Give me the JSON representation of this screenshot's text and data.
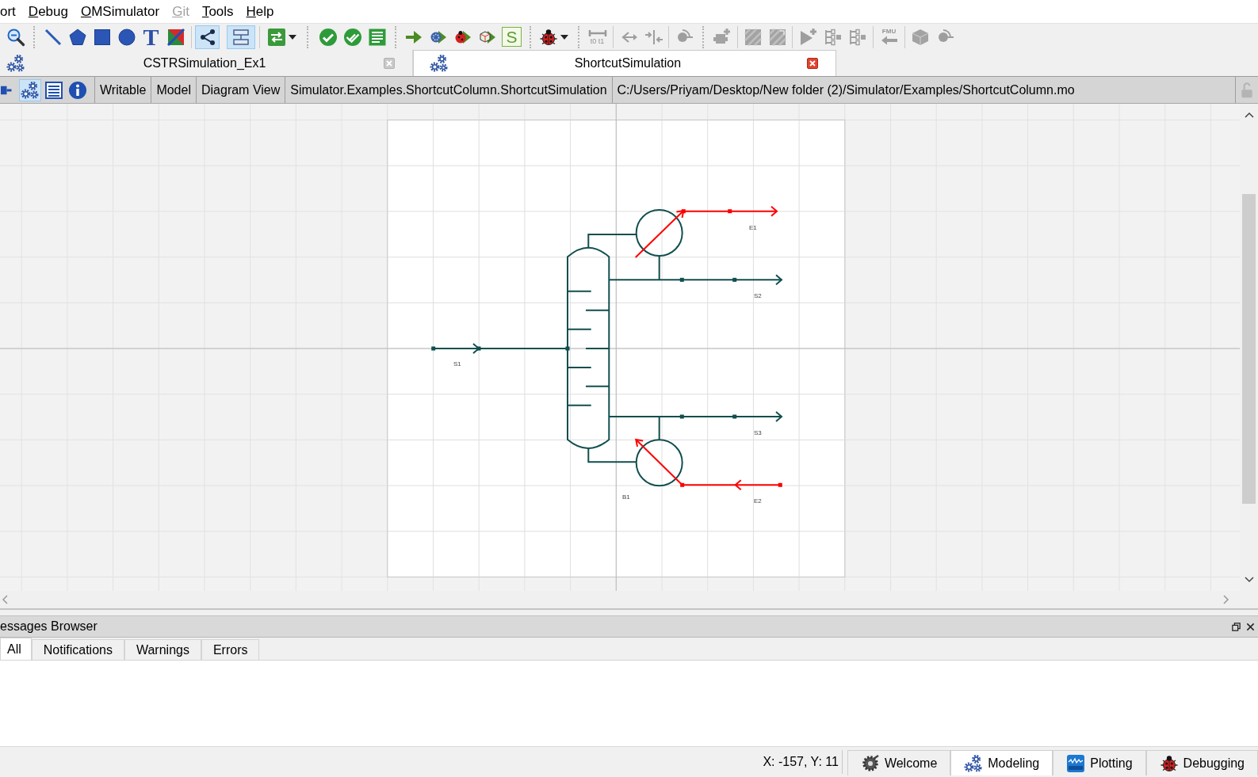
{
  "menu_bar": {
    "items": [
      {
        "label": "ort",
        "mnemonic": false,
        "disabled": false
      },
      {
        "label": "Debug",
        "mnemonic": true,
        "disabled": false
      },
      {
        "label": "OMSimulator",
        "mnemonic": true,
        "disabled": false
      },
      {
        "label": "Git",
        "mnemonic": true,
        "disabled": true
      },
      {
        "label": "Tools",
        "mnemonic": true,
        "disabled": false
      },
      {
        "label": "Help",
        "mnemonic": true,
        "disabled": false
      }
    ]
  },
  "toolbar": {
    "groups": [
      {
        "items": [
          {
            "pressed": false,
            "disabled": false
          }
        ]
      },
      {
        "items": [
          {
            "pressed": false,
            "disabled": false
          },
          {
            "pressed": false,
            "disabled": false
          },
          {
            "pressed": false,
            "disabled": false
          },
          {
            "pressed": false,
            "disabled": false
          },
          {
            "text": "T",
            "pressed": false,
            "disabled": false
          },
          {
            "pressed": false,
            "disabled": false
          }
        ]
      },
      {
        "items": [
          {
            "pressed": true,
            "disabled": false
          },
          {
            "pressed": true,
            "disabled": false
          }
        ]
      },
      {
        "items": [
          {
            "pressed": false,
            "disabled": false
          }
        ]
      },
      {
        "items": [
          {
            "pressed": false,
            "disabled": false
          },
          {
            "pressed": false,
            "disabled": false
          },
          {
            "pressed": false,
            "disabled": false
          }
        ]
      },
      {
        "items": [
          {
            "pressed": false,
            "disabled": false
          },
          {
            "pressed": false,
            "disabled": false
          },
          {
            "pressed": false,
            "disabled": false
          },
          {
            "pressed": false,
            "disabled": false
          },
          {
            "text": "S",
            "pressed": false,
            "disabled": false
          }
        ]
      },
      {
        "items": [
          {
            "pressed": false,
            "disabled": false
          }
        ]
      },
      {
        "items": [
          {
            "text": "t0 t1",
            "pressed": false,
            "disabled": true
          }
        ]
      },
      {
        "items": [
          {
            "pressed": false,
            "disabled": true
          },
          {
            "pressed": false,
            "disabled": true
          }
        ]
      },
      {
        "items": [
          {
            "pressed": false,
            "disabled": true
          }
        ]
      },
      {
        "items": [
          {
            "pressed": false,
            "disabled": true
          }
        ]
      },
      {
        "items": [
          {
            "pressed": false,
            "disabled": true
          },
          {
            "pressed": false,
            "disabled": true
          }
        ]
      },
      {
        "items": [
          {
            "pressed": false,
            "disabled": true
          },
          {
            "pressed": false,
            "disabled": true
          },
          {
            "pressed": false,
            "disabled": true
          }
        ]
      },
      {
        "items": [
          {
            "text": "FMU",
            "pressed": false,
            "disabled": true
          }
        ]
      },
      {
        "items": [
          {
            "pressed": false,
            "disabled": true
          },
          {
            "pressed": false,
            "disabled": true
          }
        ]
      }
    ]
  },
  "document_tabs": [
    {
      "title": "CSTRSimulation_Ex1",
      "selected": false
    },
    {
      "title": "ShortcutSimulation",
      "selected": true
    }
  ],
  "model_bar": {
    "view_buttons": [
      {
        "selected": false
      },
      {
        "selected": true
      },
      {
        "selected": false
      },
      {
        "selected": false
      }
    ],
    "access": "Writable",
    "restriction": "Model",
    "view": "Diagram View",
    "class_name": "Simulator.Examples.ShortcutColumn.ShortcutSimulation",
    "file_path": "C:/Users/Priyam/Desktop/New folder (2)/Simulator/Examples/ShortcutColumn.mo",
    "locked": false
  },
  "diagram": {
    "blocks": [
      {
        "kind": "column",
        "label": "B1"
      }
    ],
    "streams": [
      {
        "kind": "material",
        "label": "S1"
      },
      {
        "kind": "material",
        "label": "S2"
      },
      {
        "kind": "material",
        "label": "S3"
      },
      {
        "kind": "energy",
        "label": "E1"
      },
      {
        "kind": "energy",
        "label": "E2"
      }
    ]
  },
  "messages_browser": {
    "title": "essages Browser",
    "tabs": [
      {
        "label": "All",
        "selected": true
      },
      {
        "label": "Notifications",
        "selected": false
      },
      {
        "label": "Warnings",
        "selected": false
      },
      {
        "label": "Errors",
        "selected": false
      }
    ]
  },
  "status_bar": {
    "coordinates": "X: -157, Y: 11",
    "perspectives": [
      {
        "label": "Welcome",
        "selected": false
      },
      {
        "label": "Modeling",
        "selected": true
      },
      {
        "label": "Plotting",
        "selected": false
      },
      {
        "label": "Debugging",
        "selected": false
      }
    ]
  }
}
